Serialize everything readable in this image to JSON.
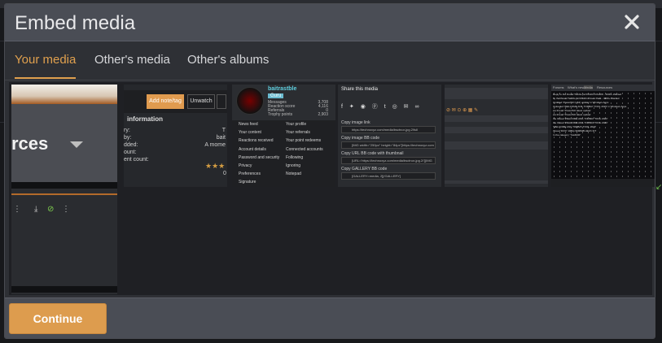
{
  "dialog": {
    "title": "Embed media",
    "close_icon": "close-icon"
  },
  "tabs": [
    {
      "label": "Your media",
      "active": true
    },
    {
      "label": "Other's media",
      "active": false
    },
    {
      "label": "Other's albums",
      "active": false
    }
  ],
  "thumbnails": {
    "t1": {
      "word": "rces"
    },
    "t2": {
      "add_note": "Add note/tag",
      "unwatch": "Unwatch",
      "info_heading": "information",
      "rows": [
        {
          "label": "ry:",
          "value": "T"
        },
        {
          "label": "by:",
          "value": "bait"
        },
        {
          "label": "dded:",
          "value": "A mome"
        },
        {
          "label": "ount:",
          "value": ""
        },
        {
          "label": "ent count:",
          "value": ""
        }
      ],
      "rating_value": "0"
    },
    "t3": {
      "username": "baitrastble",
      "rank": "Guru",
      "stats": [
        {
          "label": "Messages",
          "value": "3,708"
        },
        {
          "label": "Reaction score",
          "value": "4,116"
        },
        {
          "label": "Referrals",
          "value": "0"
        },
        {
          "label": "Trophy points",
          "value": "2,903"
        }
      ],
      "menu_left": [
        "News feed",
        "Your content",
        "Reactions received",
        "Account details",
        "Password and security",
        "Privacy",
        "Preferences",
        "Signature"
      ],
      "menu_right": [
        "Your profile",
        "Your referrals",
        "Your point redeems",
        "Connected accounts",
        "Following",
        "Ignoring",
        "Notepad"
      ]
    },
    "t4": {
      "title": "Share this media",
      "fields": [
        {
          "label": "Copy image link",
          "value": "https://technoxyz.com/media/bsctnor-jpg.2/full"
        },
        {
          "label": "Copy image BB code",
          "value": "[IMG width=\"250px\" height=\"84px\"]https://technoxyz.com"
        },
        {
          "label": "Copy URL BB code with thumbnail",
          "value": "[URL='https://technoxyz.com/media/bsctnor-jpg.2/'][IMG"
        },
        {
          "label": "Copy GALLERY BB code",
          "value": "[GALLERY=media, 2][/GALLERY]"
        }
      ]
    },
    "t6": {
      "nav_items": [
        "Forums",
        "What's new",
        "Media",
        "Resources"
      ],
      "lines": [
        "Reply to the thread Tw1Ds.jnn%%20n NXsDW - 4000+ Wanted",
        "by the thread Tw1Ds.jnn%%20n Poses Pack - 4000+ Wanted",
        "Updated 'PowerISO (x64) update' in Windows Apps",
        "Uploaded 'WELCOME ANIL TORBAY TOOL 2023' in Windows Apps",
        "ew thread 'PowerISO latest update'",
        "ew thread 'PowerISO latest update'",
        "the thread 'WELCOME ANIL TORBAY TOOL 2023'",
        "the thread 'WELCOME ANIL TORBAY TOOL 2023'",
        "'WELCOME ANIL TORBAY TOOL 2023'",
        "thread 'DIVX' 1080p 9990MB HEVC FIT",
        "In the category 'TutoRAR'"
      ]
    }
  },
  "footer": {
    "continue_label": "Continue"
  },
  "colors": {
    "accent": "#dd9c4e",
    "header_bg": "#4a4d55",
    "body_bg": "#2e3035"
  }
}
